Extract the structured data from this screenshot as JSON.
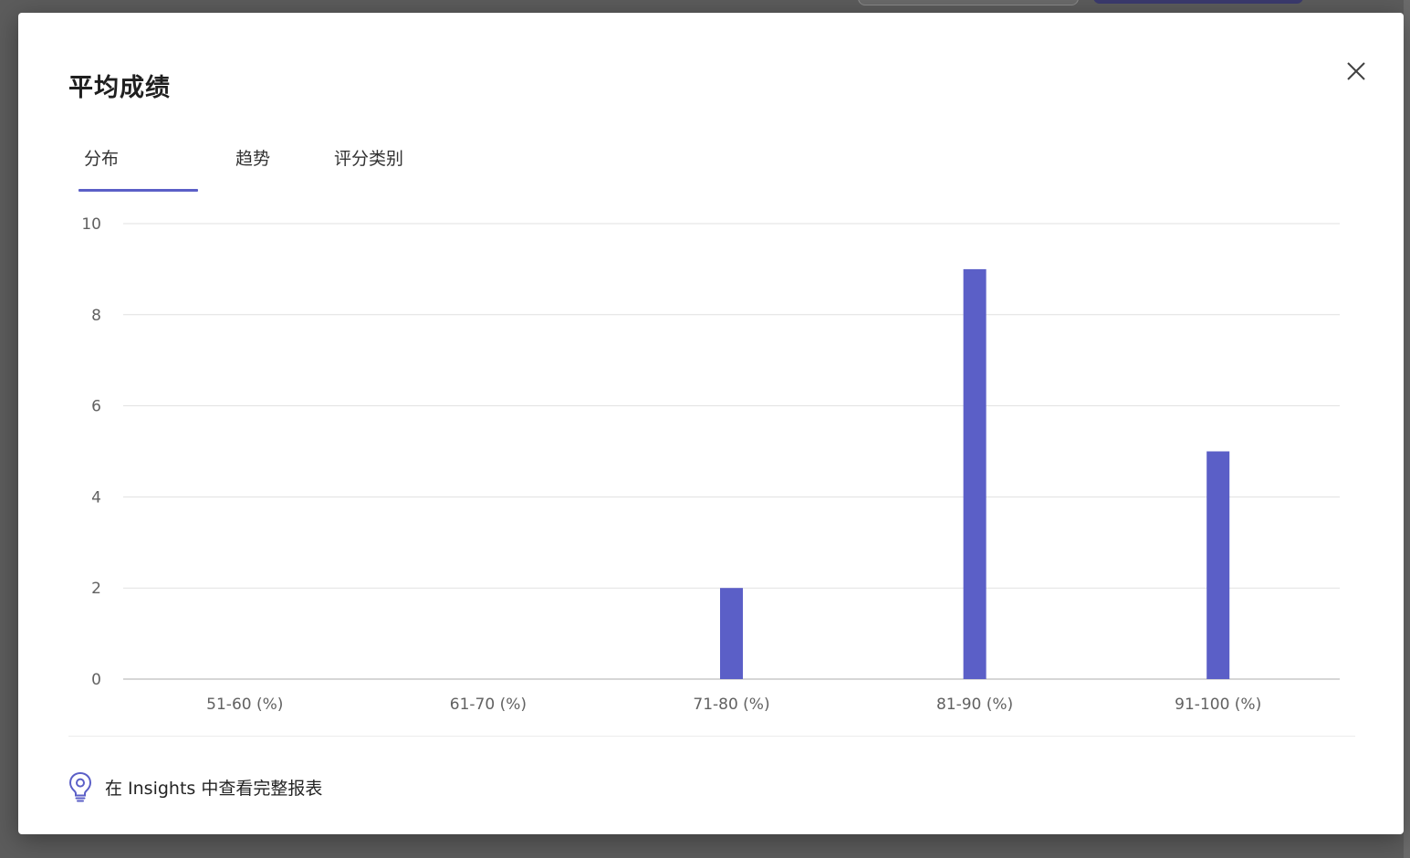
{
  "dialog": {
    "title": "平均成绩",
    "close_icon": "close-icon",
    "tabs": [
      {
        "label": "分布",
        "selected": true
      },
      {
        "label": "趋势",
        "selected": false
      },
      {
        "label": "评分类别",
        "selected": false
      }
    ],
    "footer_link": {
      "icon": "lightbulb-icon",
      "label": "在 Insights 中查看完整报表"
    }
  },
  "colors": {
    "accent": "#5b5fc7",
    "bar": "#5b5fc7",
    "grid": "#e1e1e1",
    "axis_text": "#616161"
  },
  "chart_data": {
    "type": "bar",
    "categories": [
      "51-60 (%)",
      "61-70 (%)",
      "71-80 (%)",
      "81-90 (%)",
      "91-100 (%)"
    ],
    "values": [
      0,
      0,
      2,
      9,
      5
    ],
    "ylim": [
      0,
      10
    ],
    "yticks": [
      0,
      2,
      4,
      6,
      8,
      10
    ],
    "grid": true,
    "title": "",
    "xlabel": "",
    "ylabel": ""
  }
}
